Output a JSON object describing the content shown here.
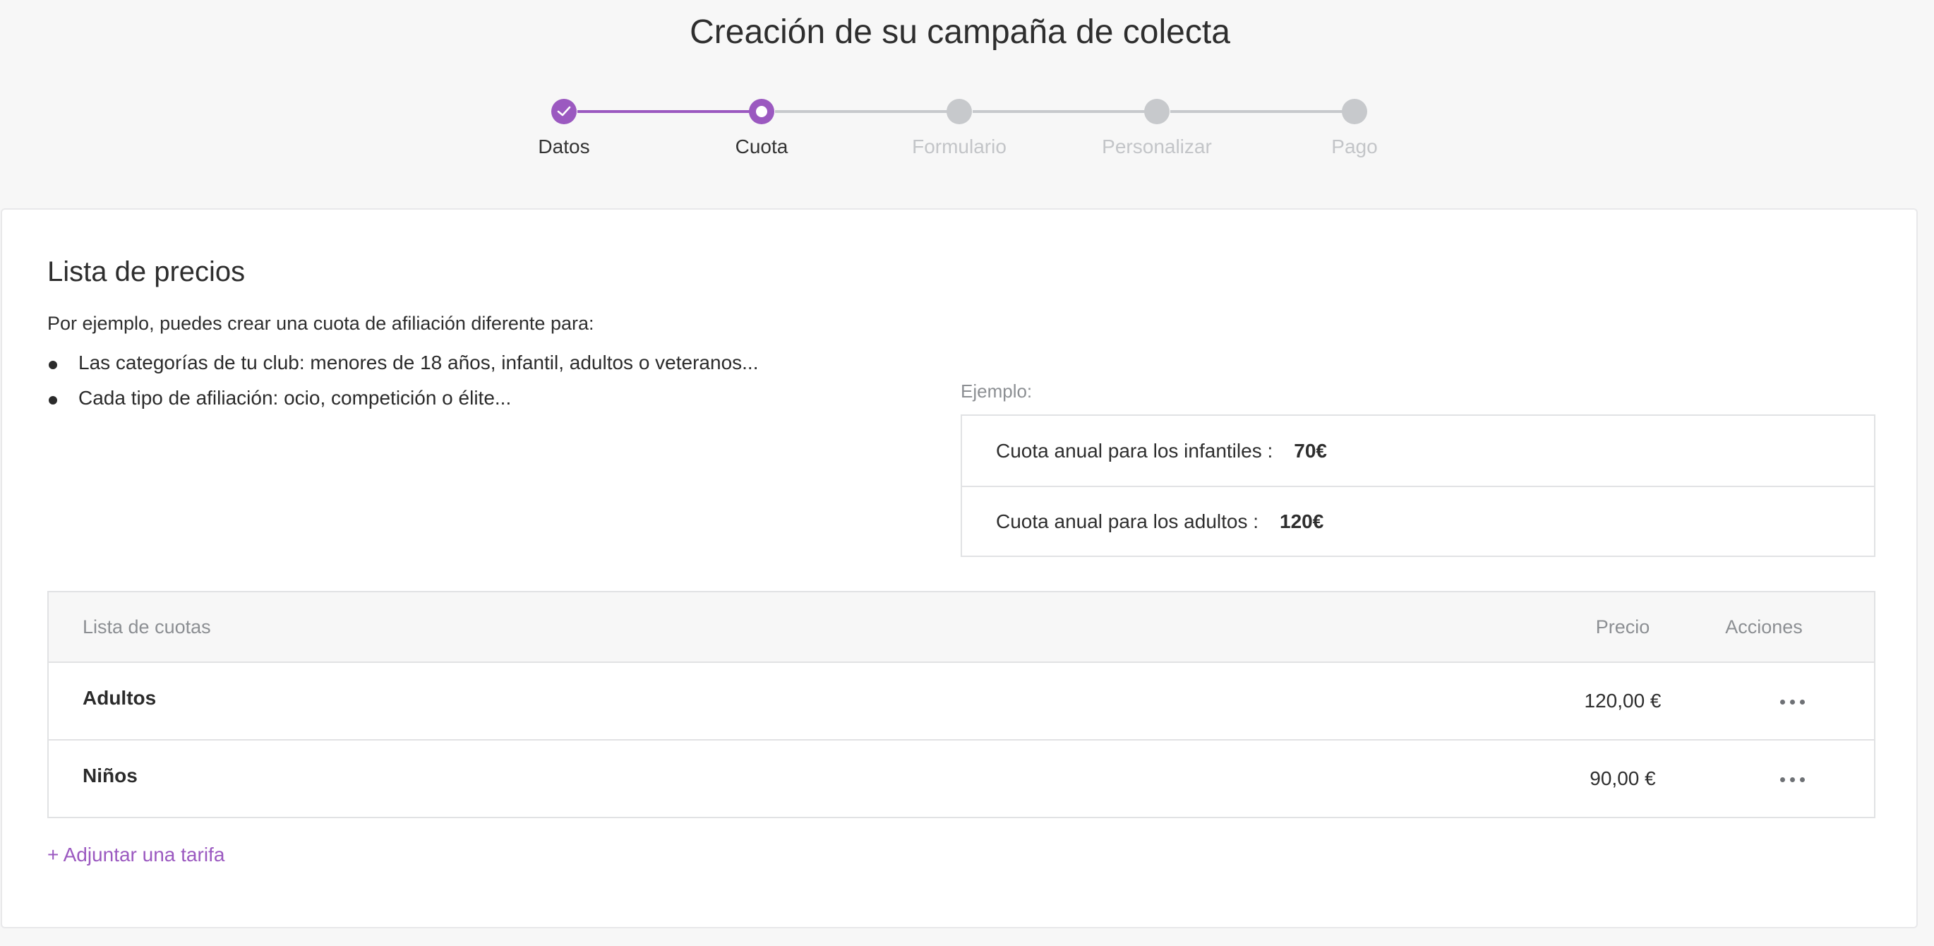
{
  "page": {
    "title": "Creación de su campaña de colecta"
  },
  "stepper": {
    "steps": [
      {
        "label": "Datos",
        "state": "done"
      },
      {
        "label": "Cuota",
        "state": "current"
      },
      {
        "label": "Formulario",
        "state": "pending"
      },
      {
        "label": "Personalizar",
        "state": "pending"
      },
      {
        "label": "Pago",
        "state": "pending"
      }
    ]
  },
  "section": {
    "title": "Lista de precios",
    "intro": "Por ejemplo, puedes crear una cuota de afiliación diferente para:",
    "bullets": [
      "Las categorías de tu club: menores de 18 años, infantil, adultos o veteranos...",
      "Cada tipo de afiliación: ocio, competición o élite..."
    ]
  },
  "example": {
    "label": "Ejemplo:",
    "rows": [
      {
        "text": "Cuota anual para los infantiles :",
        "value": "70€"
      },
      {
        "text": "Cuota anual para los adultos :",
        "value": "120€"
      }
    ]
  },
  "table": {
    "headers": {
      "name": "Lista de cuotas",
      "price": "Precio",
      "actions": "Acciones"
    },
    "rows": [
      {
        "name": "Adultos",
        "price": "120,00 €"
      },
      {
        "name": "Niños",
        "price": "90,00 €"
      }
    ]
  },
  "actions": {
    "add_rate": "+ Adjuntar una tarifa"
  },
  "colors": {
    "accent": "#9b59c0",
    "inactive": "#c7c9cc"
  },
  "icons": {
    "done_step": "check-icon",
    "row_menu": "more-horizontal-icon"
  }
}
